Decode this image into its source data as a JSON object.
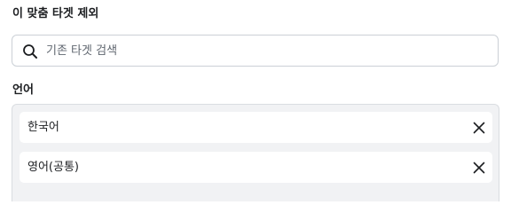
{
  "section": {
    "title": "이 맞춤 타겟 제외"
  },
  "search": {
    "icon": "search-icon",
    "placeholder": "기존 타겟 검색",
    "value": ""
  },
  "languages": {
    "label": "언어",
    "items": [
      {
        "label": "한국어",
        "remove_icon": "close-icon"
      },
      {
        "label": "영어(공통)",
        "remove_icon": "close-icon"
      }
    ]
  },
  "colors": {
    "panel_background": "#f1f2f4",
    "border": "#cbd0d6",
    "text": "#1c1e21",
    "placeholder": "#606770"
  }
}
